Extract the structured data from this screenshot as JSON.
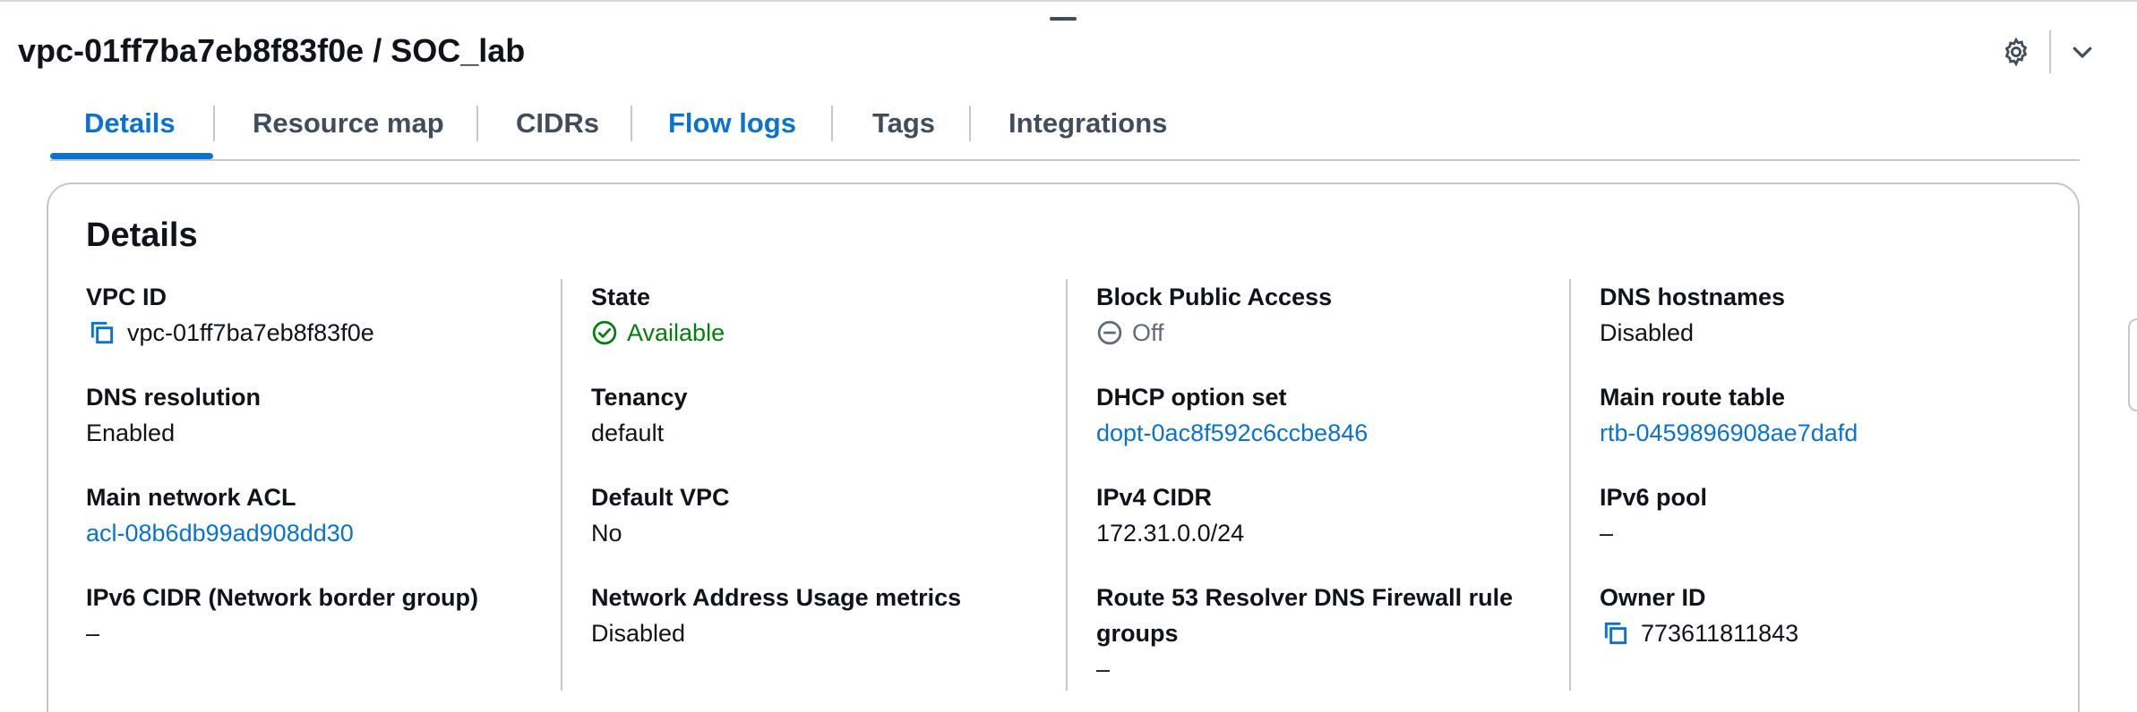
{
  "header": {
    "title": "vpc-01ff7ba7eb8f83f0e / SOC_lab",
    "icons": [
      "settings-gear-icon",
      "chevron-down-icon"
    ]
  },
  "tabs": [
    "Details",
    "Resource map",
    "CIDRs",
    "Flow logs",
    "Tags",
    "Integrations"
  ],
  "active_tab": "Details",
  "details": {
    "heading": "Details",
    "fields": {
      "vpc_id": {
        "label": "VPC ID",
        "value": "vpc-01ff7ba7eb8f83f0e"
      },
      "state": {
        "label": "State",
        "value": "Available"
      },
      "block_public_access": {
        "label": "Block Public Access",
        "value": "Off"
      },
      "dns_hostnames": {
        "label": "DNS hostnames",
        "value": "Disabled"
      },
      "dns_resolution": {
        "label": "DNS resolution",
        "value": "Enabled"
      },
      "tenancy": {
        "label": "Tenancy",
        "value": "default"
      },
      "dhcp_option_set": {
        "label": "DHCP option set",
        "value": "dopt-0ac8f592c6ccbe846"
      },
      "main_route_table": {
        "label": "Main route table",
        "value": "rtb-0459896908ae7dafd"
      },
      "main_network_acl": {
        "label": "Main network ACL",
        "value": "acl-08b6db99ad908dd30"
      },
      "default_vpc": {
        "label": "Default VPC",
        "value": "No"
      },
      "ipv4_cidr": {
        "label": "IPv4 CIDR",
        "value": "172.31.0.0/24"
      },
      "ipv6_pool": {
        "label": "IPv6 pool",
        "value": "–"
      },
      "ipv6_cidr": {
        "label": "IPv6 CIDR (Network border group)",
        "value": "–"
      },
      "network_address_usage": {
        "label": "Network Address Usage metrics",
        "value": "Disabled"
      },
      "route53_firewall": {
        "label_line1": "Route 53 Resolver DNS Firewall rule",
        "label_line2": "groups",
        "value": "–"
      },
      "owner_id": {
        "label": "Owner ID",
        "value": "773611811843"
      }
    }
  },
  "colors": {
    "link": "#0972d3",
    "status_available": "#037f0c",
    "status_off": "#5f6b7a",
    "text": "#0f141a",
    "border": "#c6c6cd"
  }
}
